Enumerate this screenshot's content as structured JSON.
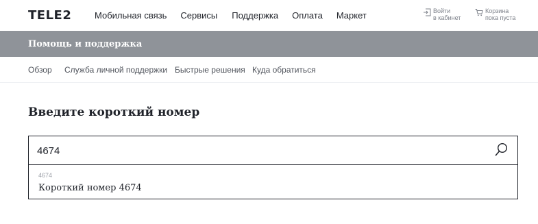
{
  "brand": {
    "logo_text": "TELE2"
  },
  "main_nav": {
    "items": [
      {
        "label": "Мобильная связь"
      },
      {
        "label": "Сервисы"
      },
      {
        "label": "Поддержка"
      },
      {
        "label": "Оплата"
      },
      {
        "label": "Маркет"
      }
    ]
  },
  "header_utils": {
    "login": {
      "line1": "Войти",
      "line2": "в кабинет",
      "icon": "login-icon"
    },
    "cart": {
      "line1": "Корзина",
      "line2": "пока пуста",
      "icon": "cart-icon"
    }
  },
  "section": {
    "title": "Помощь и поддержка"
  },
  "sub_nav": {
    "items": [
      {
        "label": "Обзор"
      },
      {
        "label": "Служба личной поддержки"
      },
      {
        "label": "Быстрые решения"
      },
      {
        "label": "Куда обратиться"
      }
    ]
  },
  "main": {
    "title": "Введите короткий номер",
    "search": {
      "value": "4674",
      "icon": "search-icon"
    },
    "suggestion": {
      "number": "4674",
      "label": "Короткий номер 4674"
    }
  },
  "colors": {
    "section_bar": "#8f9399",
    "text": "#1f2229",
    "muted": "#7c8089"
  }
}
